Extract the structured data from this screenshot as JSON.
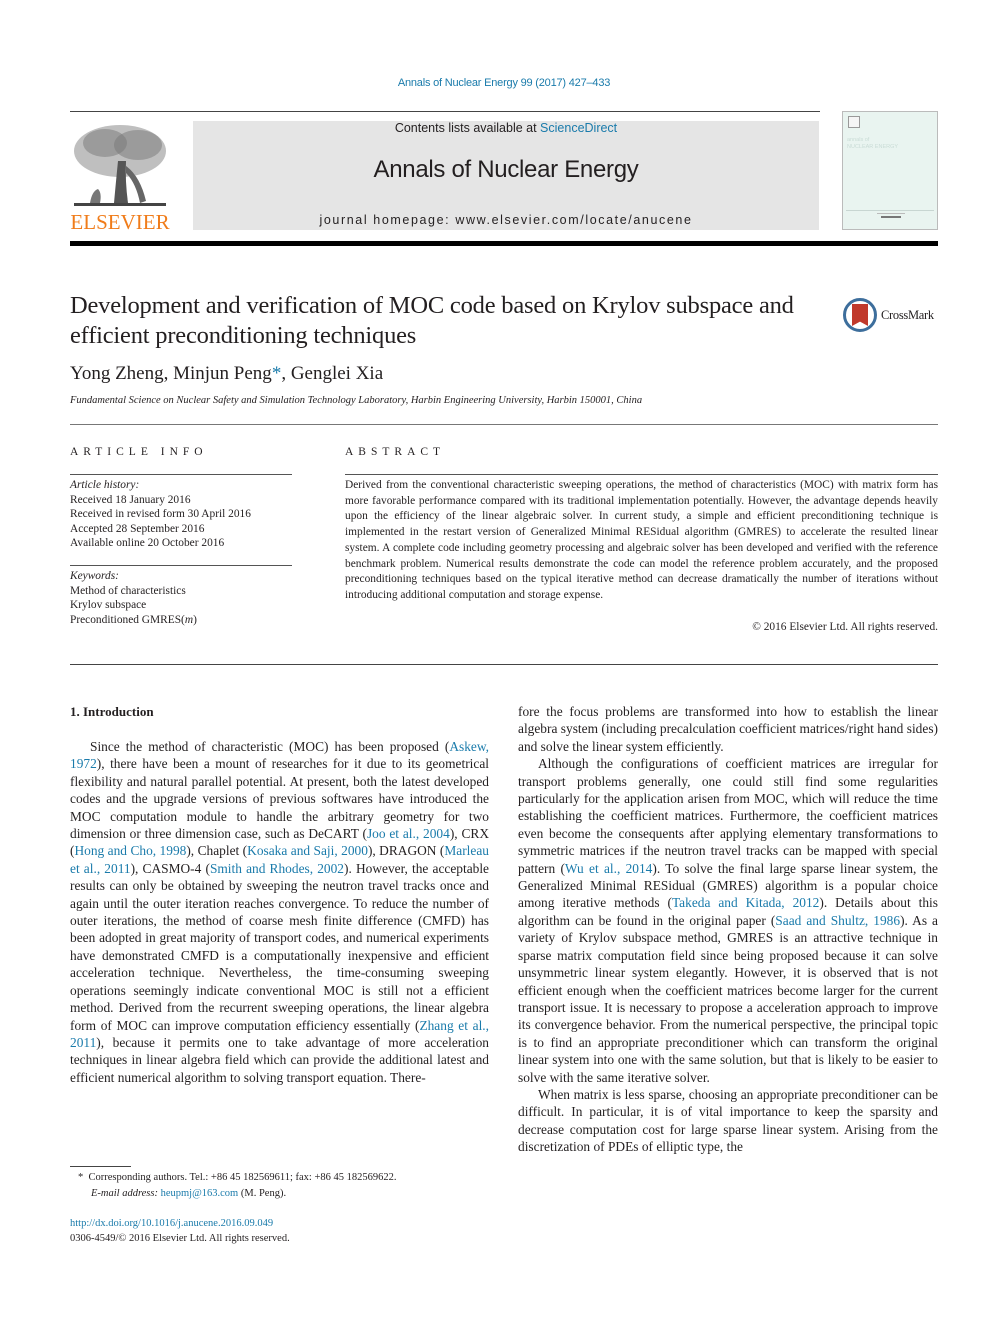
{
  "header": {
    "citation": "Annals of Nuclear Energy 99 (2017) 427–433",
    "contents_prefix": "Contents lists available at ",
    "contents_link": "ScienceDirect",
    "journal_title": "Annals of Nuclear Energy",
    "homepage_prefix": "journal homepage: ",
    "homepage_url": "www.elsevier.com/locate/anucene",
    "publisher_wordmark": "ELSEVIER",
    "cover_title_line1": "annals of",
    "cover_title_line2": "NUCLEAR ENERGY",
    "crossmark_label": "CrossMark"
  },
  "colors": {
    "link": "#1a7bab",
    "elsevier_orange": "#f07c1a",
    "banner_grey": "#e5e5e5",
    "crossmark_red": "#c0392b",
    "crossmark_blue": "#3d6e9c"
  },
  "article": {
    "title": "Development and verification of MOC code based on Krylov subspace and efficient preconditioning techniques",
    "authors": [
      {
        "name": "Yong Zheng",
        "sep": ", "
      },
      {
        "name": "Minjun Peng",
        "mark": "*",
        "sep": ", "
      },
      {
        "name": "Genglei Xia",
        "sep": ""
      }
    ],
    "affiliation": "Fundamental Science on Nuclear Safety and Simulation Technology Laboratory, Harbin Engineering University, Harbin 150001, China"
  },
  "article_info": {
    "heading": "ARTICLE INFO",
    "history_label": "Article history:",
    "history": [
      "Received 18 January 2016",
      "Received in revised form 30 April 2016",
      "Accepted 28 September 2016",
      "Available online 20 October 2016"
    ],
    "keywords_label": "Keywords:",
    "keywords": [
      "Method of characteristics",
      "Krylov subspace",
      "Preconditioned GMRES("
    ],
    "keyword3_var": "m",
    "keyword3_close": ")"
  },
  "abstract": {
    "heading": "ABSTRACT",
    "text": "Derived from the conventional characteristic sweeping operations, the method of characteristics (MOC) with matrix form has more favorable performance compared with its traditional implementation potentially. However, the advantage depends heavily upon the efficiency of the linear algebraic solver. In current study, a simple and efficient preconditioning technique is implemented in the restart version of Generalized Minimal RESidual algorithm (GMRES) to accelerate the resulted linear system. A complete code including geometry processing and algebraic solver has been developed and verified with the reference benchmark problem. Numerical results demonstrate the code can model the reference problem accurately, and the proposed preconditioning techniques based on the typical iterative method can decrease dramatically the number of iterations without introducing additional computation and storage expense.",
    "copyright": "© 2016 Elsevier Ltd. All rights reserved."
  },
  "body": {
    "section_heading": "1. Introduction",
    "left_paragraph": [
      {
        "t": "Since the method of characteristic (MOC) has been proposed ("
      },
      {
        "t": "Askew, 1972",
        "link": true
      },
      {
        "t": "), there have been a mount of researches for it due to its geometrical flexibility and natural parallel potential. At present, both the latest developed codes and the upgrade versions of previous softwares have introduced the MOC computation module to handle the arbitrary geometry for two dimension or three dimension case, such as DeCART ("
      },
      {
        "t": "Joo et al., 2004",
        "link": true
      },
      {
        "t": "), CRX ("
      },
      {
        "t": "Hong and Cho, 1998",
        "link": true
      },
      {
        "t": "), Chaplet ("
      },
      {
        "t": "Kosaka and Saji, 2000",
        "link": true
      },
      {
        "t": "), DRAGON ("
      },
      {
        "t": "Marleau et al., 2011",
        "link": true
      },
      {
        "t": "), CASMO-4 ("
      },
      {
        "t": "Smith and Rhodes, 2002",
        "link": true
      },
      {
        "t": "). However, the acceptable results can only be obtained by sweeping the neutron travel tracks once and again until the outer iteration reaches convergence. To reduce the number of outer iterations, the method of coarse mesh finite difference (CMFD) has been adopted in great majority of transport codes, and numerical experiments have demonstrated CMFD is a computationally inexpensive and efficient acceleration technique. Nevertheless, the time-consuming sweeping operations seemingly indicate conventional MOC is still not a efficient method. Derived from the recurrent sweeping operations, the linear algebra form of MOC can improve computation efficiency essentially ("
      },
      {
        "t": "Zhang et al., 2011",
        "link": true
      },
      {
        "t": "), because it permits one to take advantage of more acceleration techniques in linear algebra field which can provide the additional latest and efficient numerical algorithm to solving transport equation. There-"
      }
    ],
    "right_paragraphs": [
      {
        "indent": false,
        "parts": [
          {
            "t": "fore the focus problems are transformed into how to establish the linear algebra system (including precalculation coefficient matrices/right hand sides) and solve the linear system efficiently."
          }
        ]
      },
      {
        "indent": true,
        "parts": [
          {
            "t": "Although the configurations of coefficient matrices are irregular for transport problems generally, one could still find some regularities particularly for the application arisen from MOC, which will reduce the time establishing the coefficient matrices. Furthermore, the coefficient matrices even become the consequents after applying elementary transformations to symmetric matrices if the neutron travel tracks can be mapped with special pattern ("
          },
          {
            "t": "Wu et al., 2014",
            "link": true
          },
          {
            "t": "). To solve the final large sparse linear system, the Generalized Minimal RESidual (GMRES) algorithm is a popular choice among iterative methods ("
          },
          {
            "t": "Takeda and Kitada, 2012",
            "link": true
          },
          {
            "t": "). Details about this algorithm can be found in the original paper ("
          },
          {
            "t": "Saad and Shultz, 1986",
            "link": true
          },
          {
            "t": "). As a variety of Krylov subspace method, GMRES is an attractive technique in sparse matrix computation field since being proposed because it can solve unsymmetric linear system elegantly. However, it is observed that is not efficient enough when the coefficient matrices become larger for the current transport issue. It is necessary to propose a acceleration approach to improve its convergence behavior. From the numerical perspective, the principal topic is to find an appropriate preconditioner which can transform the original linear system into one with the same solution, but that is likely to be easier to solve with the same iterative solver."
          }
        ]
      },
      {
        "indent": true,
        "parts": [
          {
            "t": "When matrix is less sparse, choosing an appropriate preconditioner can be difficult. In particular, it is of vital importance to keep the sparsity and decrease computation cost for large sparse linear system. Arising from the discretization of PDEs of elliptic type, the"
          }
        ]
      }
    ]
  },
  "footnotes": {
    "mark": "*",
    "corresponding": "Corresponding authors. Tel.: +86 45 182569611; fax: +86 45 182569622.",
    "email_label": "E-mail address:",
    "email": "heupmj@163.com",
    "email_suffix": " (M. Peng).",
    "doi": "http://dx.doi.org/10.1016/j.anucene.2016.09.049",
    "issn_copyright": "0306-4549/© 2016 Elsevier Ltd. All rights reserved."
  }
}
